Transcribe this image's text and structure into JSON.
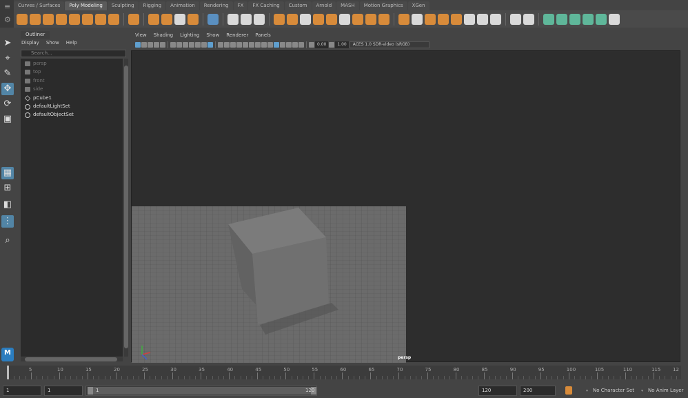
{
  "shelf_tabs": [
    "Curves / Surfaces",
    "Poly Modeling",
    "Sculpting",
    "Rigging",
    "Animation",
    "Rendering",
    "FX",
    "FX Caching",
    "Custom",
    "Arnold",
    "MASH",
    "Motion Graphics",
    "XGen"
  ],
  "active_shelf": "Poly Modeling",
  "shelf_left_glyphs": [
    "≡",
    "⚙"
  ],
  "outliner": {
    "tab": "Outliner",
    "menu": [
      "Display",
      "Show",
      "Help"
    ],
    "search_placeholder": "Search...",
    "items": [
      {
        "label": "persp",
        "icon": "camera-icon",
        "dim": true
      },
      {
        "label": "top",
        "icon": "camera-icon",
        "dim": true
      },
      {
        "label": "front",
        "icon": "camera-icon",
        "dim": true
      },
      {
        "label": "side",
        "icon": "camera-icon",
        "dim": true
      },
      {
        "label": "pCube1",
        "icon": "mesh-icon",
        "dim": false
      },
      {
        "label": "defaultLightSet",
        "icon": "set-icon",
        "dim": false
      },
      {
        "label": "defaultObjectSet",
        "icon": "set-icon",
        "dim": false
      }
    ]
  },
  "viewport": {
    "menu": [
      "View",
      "Shading",
      "Lighting",
      "Show",
      "Renderer",
      "Panels"
    ],
    "exposure": "0.00",
    "gamma": "1.00",
    "color_space": "ACES 1.0 SDR-video (sRGB)",
    "camera_label": "persp"
  },
  "left_tools": {
    "logo_text": "M"
  },
  "timeline": {
    "labels": [
      "5",
      "10",
      "15",
      "20",
      "25",
      "30",
      "35",
      "40",
      "45",
      "50",
      "55",
      "60",
      "65",
      "70",
      "75",
      "80",
      "85",
      "90",
      "95",
      "100",
      "105",
      "110",
      "115",
      "12"
    ]
  },
  "range": {
    "start_time": "1",
    "playback_start": "1",
    "slider_start": "1",
    "slider_end": "120",
    "playback_end": "120",
    "end_time": "200",
    "character_set": "No Character Set",
    "anim_layer": "No Anim Layer"
  }
}
